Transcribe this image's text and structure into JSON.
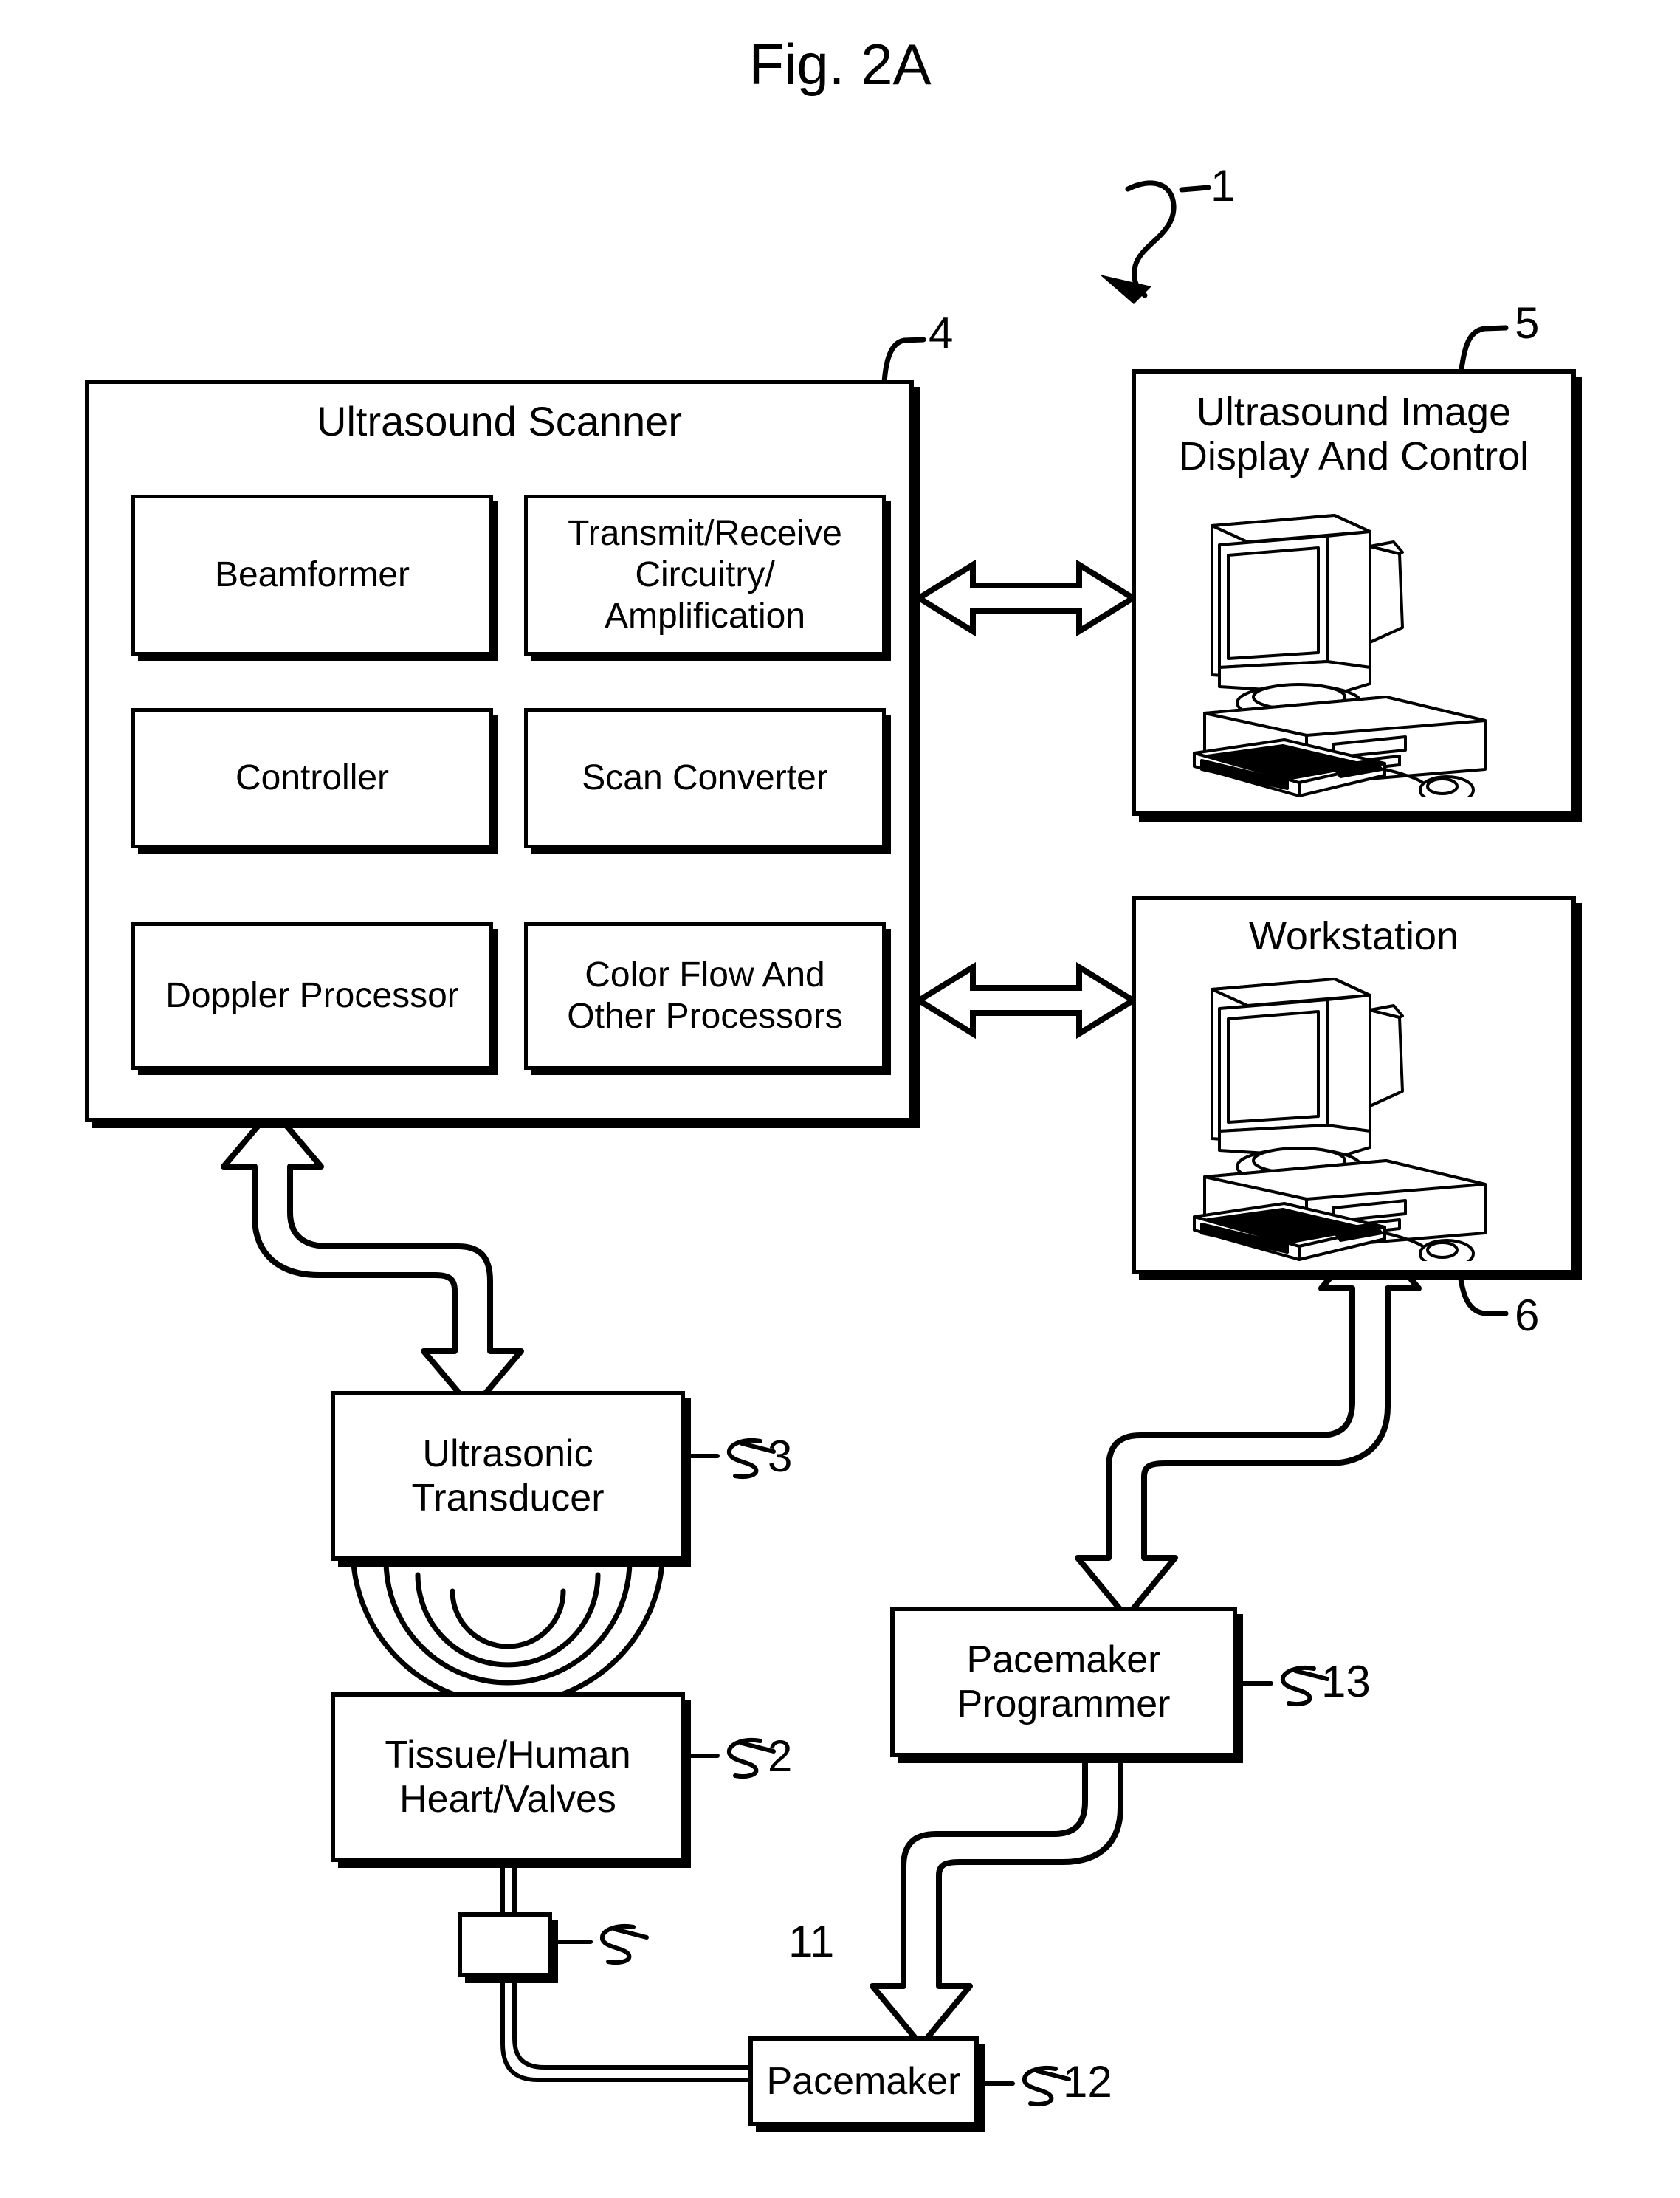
{
  "figure": {
    "title": "Fig. 2A",
    "system_ref": "1"
  },
  "scanner": {
    "title": "Ultrasound Scanner",
    "ref": "4",
    "modules": [
      {
        "label": "Beamformer",
        "name": "beamformer"
      },
      {
        "label": "Transmit/Receive\nCircuitry/\nAmplification",
        "name": "transmit-receive-circuitry-amplification"
      },
      {
        "label": "Controller",
        "name": "controller"
      },
      {
        "label": "Scan Converter",
        "name": "scan-converter"
      },
      {
        "label": "Doppler Processor",
        "name": "doppler-processor"
      },
      {
        "label": "Color Flow And\nOther Processors",
        "name": "color-flow-and-other-processors"
      }
    ]
  },
  "display_control": {
    "title": "Ultrasound Image\nDisplay And Control",
    "ref": "5",
    "icon": "desktop-computer-icon"
  },
  "workstation": {
    "title": "Workstation",
    "ref": "6",
    "icon": "desktop-computer-icon"
  },
  "transducer": {
    "title": "Ultrasonic\nTransducer",
    "ref": "3"
  },
  "tissue": {
    "title": "Tissue/Human\nHeart/Valves",
    "ref": "2"
  },
  "lead_component": {
    "title": "",
    "ref": "11"
  },
  "pacemaker": {
    "title": "Pacemaker",
    "ref": "12"
  },
  "pacemaker_programmer": {
    "title": "Pacemaker\nProgrammer",
    "ref": "13"
  },
  "connectors": {
    "scanner_to_display": "bidirectional-block-arrow",
    "scanner_to_workstation": "bidirectional-block-arrow",
    "scanner_to_transducer": "s-shaped-bidirectional-block-arrow",
    "programmer_to_workstation": "s-shaped-bidirectional-block-arrow",
    "pacemaker_to_programmer": "s-shaped-bidirectional-block-arrow",
    "transducer_to_tissue": "ultrasound-wave-arcs",
    "tissue_to_pacemaker": "lead-wire"
  },
  "colors": {
    "line": "#000000",
    "background": "#ffffff"
  }
}
